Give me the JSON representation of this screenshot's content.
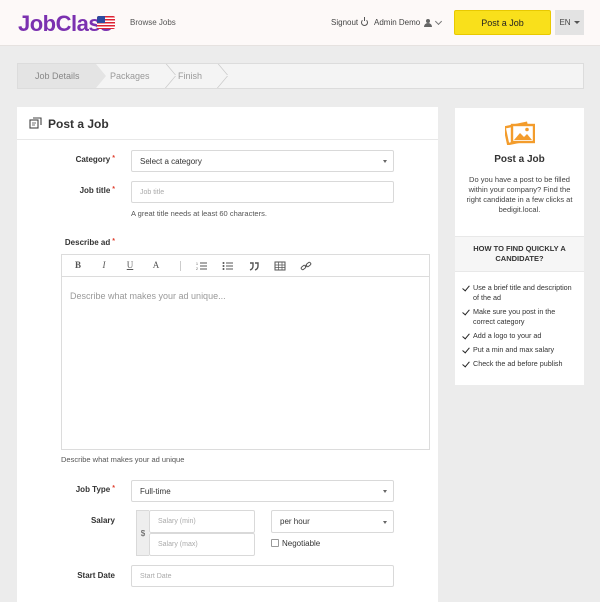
{
  "header": {
    "logo": "JobClass",
    "browse_jobs": "Browse Jobs",
    "signout": "Signout",
    "user_name": "Admin Demo",
    "post_job": "Post a Job",
    "language": "EN"
  },
  "steps": [
    "Job Details",
    "Packages",
    "Finish"
  ],
  "form": {
    "title": "Post a Job",
    "required_mark": "*",
    "category_label": "Category",
    "category_value": "Select a category",
    "job_title_label": "Job title",
    "job_title_placeholder": "Job title",
    "job_title_hint": "A great title needs at least 60 characters.",
    "describe_label": "Describe ad",
    "describe_placeholder": "Describe what makes your ad unique...",
    "describe_hint": "Describe what makes your ad unique",
    "job_type_label": "Job Type",
    "job_type_value": "Full-time",
    "salary_label": "Salary",
    "currency": "$",
    "salary_min_placeholder": "Salary (min)",
    "salary_max_placeholder": "Salary (max)",
    "salary_period": "per hour",
    "negotiable_label": "Negotiable",
    "start_date_label": "Start Date",
    "start_date_placeholder": "Start Date"
  },
  "toolbar": {
    "bold": "B",
    "italic": "I",
    "underline": "U",
    "heading": "A"
  },
  "icons": [
    "note-icon",
    "ordered-list-icon",
    "unordered-list-icon",
    "quote-icon",
    "table-icon",
    "link-icon",
    "photo-icon",
    "check-icon"
  ],
  "sidebar": {
    "title": "Post a Job",
    "description": "Do you have a post to be filled within your company? Find the right candidate in a few clicks at bedigit.local.",
    "how_title": "HOW TO FIND QUICKLY A CANDIDATE?",
    "tips": [
      "Use a brief title and description of the ad",
      "Make sure you post in the correct category",
      "Add a logo to your ad",
      "Put a min and max salary",
      "Check the ad before publish"
    ]
  },
  "colors": {
    "brand": "#7b31b0",
    "accent": "#f9e01b",
    "required": "#e0402f",
    "icon_orange": "#f39c2c"
  }
}
